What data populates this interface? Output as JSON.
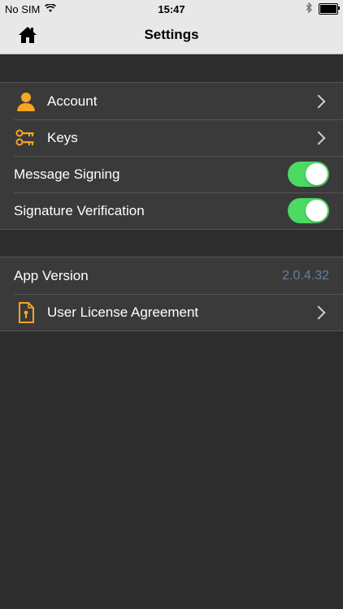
{
  "status_bar": {
    "carrier": "No SIM",
    "time": "15:47"
  },
  "nav": {
    "title": "Settings"
  },
  "section1": {
    "account_label": "Account",
    "keys_label": "Keys",
    "message_signing_label": "Message Signing",
    "message_signing_on": true,
    "signature_verification_label": "Signature Verification",
    "signature_verification_on": true
  },
  "section2": {
    "app_version_label": "App Version",
    "app_version_value": "2.0.4.32",
    "license_label": "User License Agreement"
  },
  "colors": {
    "icon_orange": "#f5a623",
    "toggle_on": "#4cd964",
    "version_text": "#6a7ea0"
  }
}
